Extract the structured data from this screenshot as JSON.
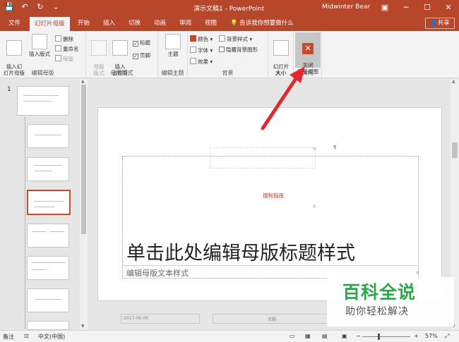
{
  "window": {
    "title": "演示文稿1 - PowerPoint",
    "user": "Midwinter Bear",
    "buttons": {
      "minimize": "─",
      "maximize": "☐",
      "close": "✕"
    }
  },
  "tabs": {
    "file": "文件",
    "slide_master": "幻灯片母版",
    "home": "开始",
    "insert": "插入",
    "transitions": "切换",
    "animations": "动画",
    "review": "审阅",
    "view": "视图",
    "tell_me": "告诉我你想要做什么",
    "share": "共享"
  },
  "ribbon": {
    "edit_master": {
      "label": "编辑母版",
      "insert_slide_master": "插入幻\n灯片母版",
      "insert_layout": "插入版式",
      "delete": "删除",
      "rename": "重命名",
      "preserve": "保留"
    },
    "master_layout": {
      "label": "母版版式",
      "master_layout_btn": "母版\n版式",
      "insert_placeholder": "插入\n占位符",
      "title_cb": "标题",
      "footer_cb": "页脚"
    },
    "edit_theme": {
      "label": "编辑主题",
      "theme": "主题"
    },
    "background": {
      "label": "背景",
      "colors": "颜色",
      "fonts": "字体",
      "effects": "效果",
      "bg_styles": "背景样式",
      "hide_bg": "隐藏背景图形"
    },
    "size": {
      "label": "大小",
      "slide_size": "幻灯片\n大小"
    },
    "close": {
      "label": "关闭",
      "close_master": "关闭\n母版视图"
    }
  },
  "thumbs": {
    "slide_number": "1"
  },
  "slide": {
    "title_placeholder": "单击此处编辑母版标题样式",
    "body_placeholder": "编辑母版文本样式",
    "center_label": "搜狗指南",
    "footer_date": "2017-06-09",
    "footer_mid": "页脚",
    "mark": "¶"
  },
  "status": {
    "notes": "备注",
    "language": "中文(中国)",
    "zoom": "57%",
    "zoom_level": 0.57
  },
  "watermark": {
    "big": "百科全说",
    "small": "助你轻松解决"
  },
  "colors": {
    "accent": "#b7472a",
    "watermark_green": "#2aa84a",
    "arrow_red": "#e0282e"
  }
}
